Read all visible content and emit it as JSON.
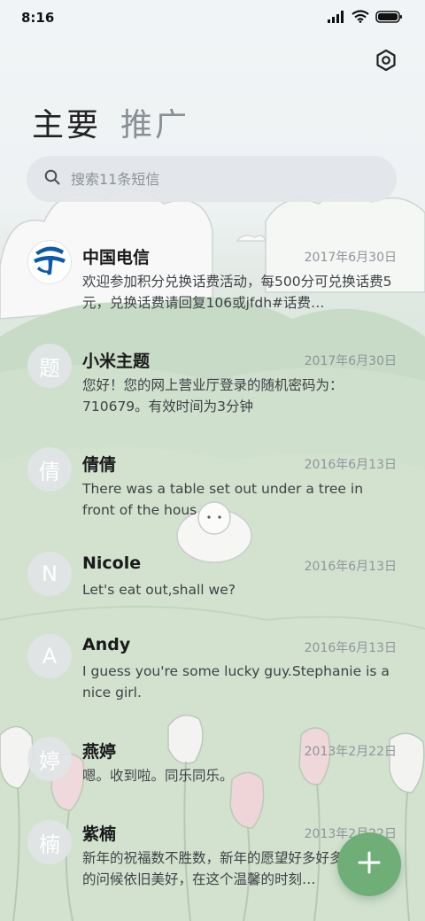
{
  "status_bar": {
    "time": "8:16"
  },
  "tabs": [
    {
      "label": "主要",
      "active": true
    },
    {
      "label": "推广",
      "active": false
    }
  ],
  "search": {
    "placeholder": "搜索11条短信"
  },
  "conversations": [
    {
      "name": "中国电信",
      "date": "2017年6月30日",
      "preview": "欢迎参加积分兑换话费活动，每500分可兑换话费5元，兑换话费请回复106或jfdh#话费…",
      "avatar": "",
      "avatar_icon": "china-telecom-logo"
    },
    {
      "name": "小米主题",
      "date": "2017年6月30日",
      "preview": "您好！您的网上营业厅登录的随机密码为：710679。有效时间为3分钟",
      "avatar": "题"
    },
    {
      "name": "倩倩",
      "date": "2016年6月13日",
      "preview": "There was a table set out under a tree in front of the hous",
      "avatar": "倩"
    },
    {
      "name": "Nicole",
      "date": "2016年6月13日",
      "preview": "Let's eat out,shall we?",
      "avatar": "N"
    },
    {
      "name": "Andy",
      "date": "2016年6月13日",
      "preview": "I guess you're some lucky guy.Stephanie is a nice girl.",
      "avatar": "A"
    },
    {
      "name": "燕婷",
      "date": "2013年2月22日",
      "preview": "嗯。收到啦。同乐同乐。",
      "avatar": "婷"
    },
    {
      "name": "紫楠",
      "date": "2013年2月22日",
      "preview": "新年的祝福数不胜数，新年的愿望好多好多，新年的问候依旧美好，在这个温馨的时刻…",
      "avatar": "楠"
    }
  ],
  "fab": {
    "icon": "plus-icon"
  },
  "colors": {
    "accent": "#6fae76",
    "muted_text": "#8f959b"
  }
}
